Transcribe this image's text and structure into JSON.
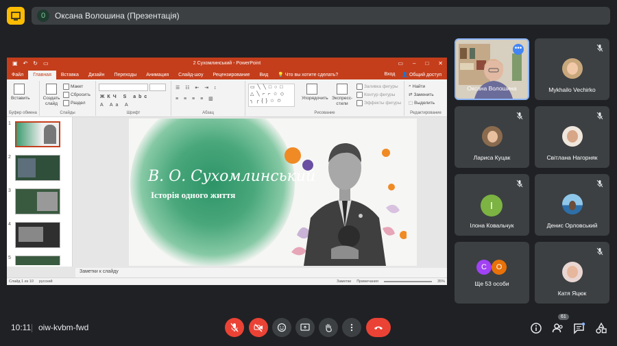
{
  "presenter": {
    "avatar_letter": "0",
    "label": "Оксана Волошина (Презентація)"
  },
  "ppt": {
    "doc_title": "2 Сухомлинський - PowerPoint",
    "tabs": [
      "Файл",
      "Главная",
      "Вставка",
      "Дизайн",
      "Переходы",
      "Анимация",
      "Слайд-шоу",
      "Рецензирование",
      "Вид"
    ],
    "active_tab": "Главная",
    "tell_me": "Что вы хотите сделать?",
    "sign_in": "Вход",
    "share": "Общий доступ",
    "ribbon": {
      "paste": "Вставить",
      "clipboard": "Буфер обмена",
      "new_slide": "Создать слайд",
      "layout": "Макет",
      "reset": "Сбросить",
      "section": "Раздел",
      "slides": "Слайды",
      "font": "Шрифт",
      "paragraph": "Абзац",
      "arrange": "Упорядочить",
      "quick_styles": "Экспресс-стили",
      "fill": "Заливка фигуры",
      "outline": "Контур фигуры",
      "effects": "Эффекты фигуры",
      "drawing": "Рисование",
      "find": "Найти",
      "replace": "Заменить",
      "select": "Выделить",
      "editing": "Редактирование"
    },
    "thumb_numbers": [
      "1",
      "2",
      "3",
      "4",
      "5"
    ],
    "slide": {
      "title": "В. О. Сухомлинський",
      "subtitle": "Історія одного життя"
    },
    "notes": "Заметки к слайду",
    "status": {
      "slide_of": "Слайд 1 из 10",
      "lang": "русский",
      "notes_btn": "Заметки",
      "comments_btn": "Примечания",
      "zoom": "35%"
    }
  },
  "tiles": [
    {
      "name": "Оксана Волошина",
      "active": true
    },
    {
      "name": "Mykhailo Vechirko"
    },
    {
      "name": "Лариса Куцак"
    },
    {
      "name": "Світлана Нагорняк"
    },
    {
      "name": "Ілона Ковальчук",
      "letter": "I",
      "color": "#7cb342"
    },
    {
      "name": "Денис Орловський"
    },
    {
      "name": "Ще 53 особи",
      "letters": [
        "C",
        "O"
      ],
      "colors": [
        "#a142f4",
        "#e8710a"
      ]
    },
    {
      "name": "Катя Яцюк"
    }
  ],
  "bottom": {
    "time": "10:11",
    "meeting_code": "oiw-kvbm-fwd",
    "participants_count": "61"
  },
  "colors": {
    "accent_ppt": "#c43e1c",
    "meet_red": "#ea4335",
    "tile_bg": "#3c4043"
  }
}
